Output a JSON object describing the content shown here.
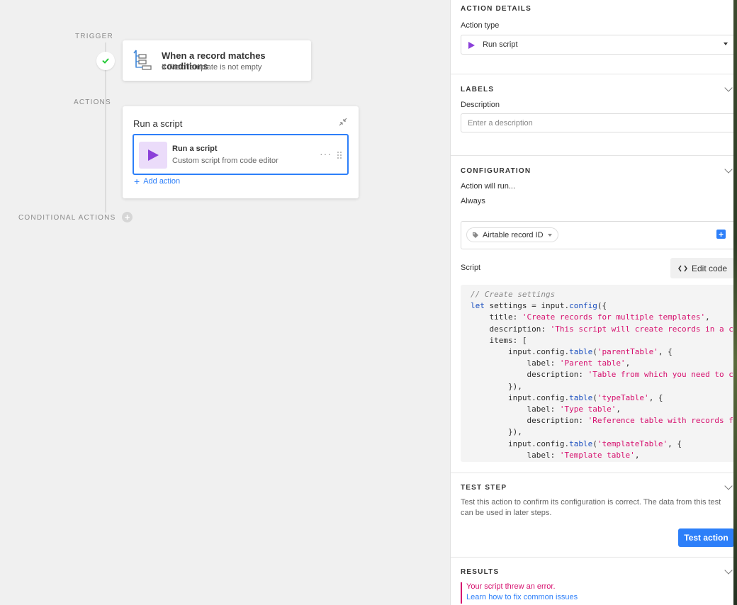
{
  "canvas": {
    "trigger_label": "TRIGGER",
    "actions_label": "ACTIONS",
    "conditional_label": "CONDITIONAL ACTIONS",
    "trigger_card": {
      "title": "When a record matches conditions",
      "subtitle": "If Task Template is not empty"
    },
    "action_card": {
      "title": "Run a script",
      "step_title": "Run a script",
      "step_subtitle": "Custom script from code editor",
      "add_action": "Add action"
    }
  },
  "panel": {
    "action_details": {
      "heading": "ACTION DETAILS",
      "type_label": "Action type",
      "type_value": "Run script"
    },
    "labels": {
      "heading": "LABELS",
      "description_label": "Description",
      "description_placeholder": "Enter a description"
    },
    "configuration": {
      "heading": "CONFIGURATION",
      "will_run_label": "Action will run...",
      "will_run_value": "Always",
      "input_variable": "Airtable record ID",
      "script_label": "Script",
      "edit_code": "Edit code",
      "code_lines": [
        [
          {
            "t": "// Create settings",
            "c": "cm"
          }
        ],
        [
          {
            "t": "let",
            "c": "kw"
          },
          {
            "t": " settings = input."
          },
          {
            "t": "config",
            "c": "fn"
          },
          {
            "t": "({"
          }
        ],
        [
          {
            "t": "    title: "
          },
          {
            "t": "'Create records for multiple templates'",
            "c": "st"
          },
          {
            "t": ","
          }
        ],
        [
          {
            "t": "    description: "
          },
          {
            "t": "'This script will create records in a ch",
            "c": "st"
          }
        ],
        [
          {
            "t": "    items: ["
          }
        ],
        [
          {
            "t": "        input.config."
          },
          {
            "t": "table",
            "c": "fn"
          },
          {
            "t": "("
          },
          {
            "t": "'parentTable'",
            "c": "st"
          },
          {
            "t": ", {"
          }
        ],
        [
          {
            "t": "            label: "
          },
          {
            "t": "'Parent table'",
            "c": "st"
          },
          {
            "t": ","
          }
        ],
        [
          {
            "t": "            description: "
          },
          {
            "t": "'Table from which you need to cr",
            "c": "st"
          }
        ],
        [
          {
            "t": "        }),"
          }
        ],
        [
          {
            "t": "        input.config."
          },
          {
            "t": "table",
            "c": "fn"
          },
          {
            "t": "("
          },
          {
            "t": "'typeTable'",
            "c": "st"
          },
          {
            "t": ", {"
          }
        ],
        [
          {
            "t": "            label: "
          },
          {
            "t": "'Type table'",
            "c": "st"
          },
          {
            "t": ","
          }
        ],
        [
          {
            "t": "            description: "
          },
          {
            "t": "'Reference table with records fo",
            "c": "st"
          }
        ],
        [
          {
            "t": "        }),"
          }
        ],
        [
          {
            "t": "        input.config."
          },
          {
            "t": "table",
            "c": "fn"
          },
          {
            "t": "("
          },
          {
            "t": "'templateTable'",
            "c": "st"
          },
          {
            "t": ", {"
          }
        ],
        [
          {
            "t": "            label: "
          },
          {
            "t": "'Template table'",
            "c": "st"
          },
          {
            "t": ","
          }
        ]
      ]
    },
    "test_step": {
      "heading": "TEST STEP",
      "description": "Test this action to confirm its configuration is correct. The data from this test can be used in later steps.",
      "button": "Test action"
    },
    "results": {
      "heading": "RESULTS",
      "error": "Your script threw an error.",
      "link": "Learn how to fix common issues"
    }
  },
  "colors": {
    "accent": "#2d7ff9",
    "script_purple": "#8b3fd9",
    "error": "#d6106e",
    "success": "#20c933"
  }
}
